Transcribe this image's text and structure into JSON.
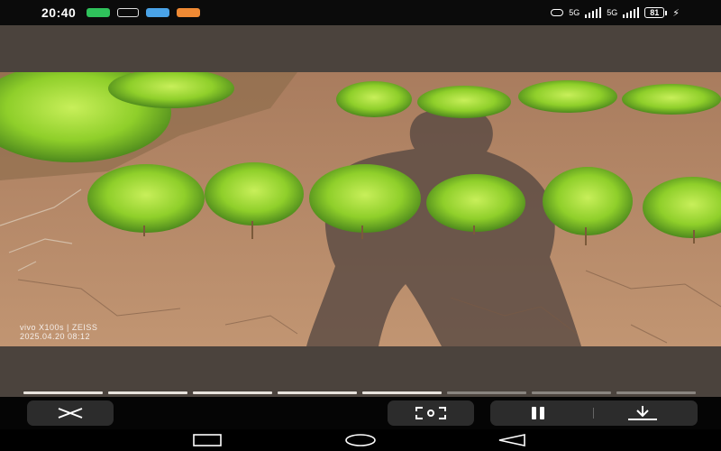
{
  "status": {
    "time": "20:40",
    "signal1": "5G",
    "signal2": "5G",
    "battery": "81"
  },
  "photo": {
    "watermark_line1": "vivo X100s | ZEISS",
    "watermark_line2": "2025.04.20 08:12"
  },
  "progress": {
    "segments": 8,
    "active": 5
  },
  "icons": {
    "close": "close-icon",
    "screenshot": "screen-capture-icon",
    "pause": "pause-icon",
    "download": "download-icon",
    "nav_recent": "square-icon",
    "nav_home": "circle-icon",
    "nav_back": "triangle-back-icon"
  }
}
